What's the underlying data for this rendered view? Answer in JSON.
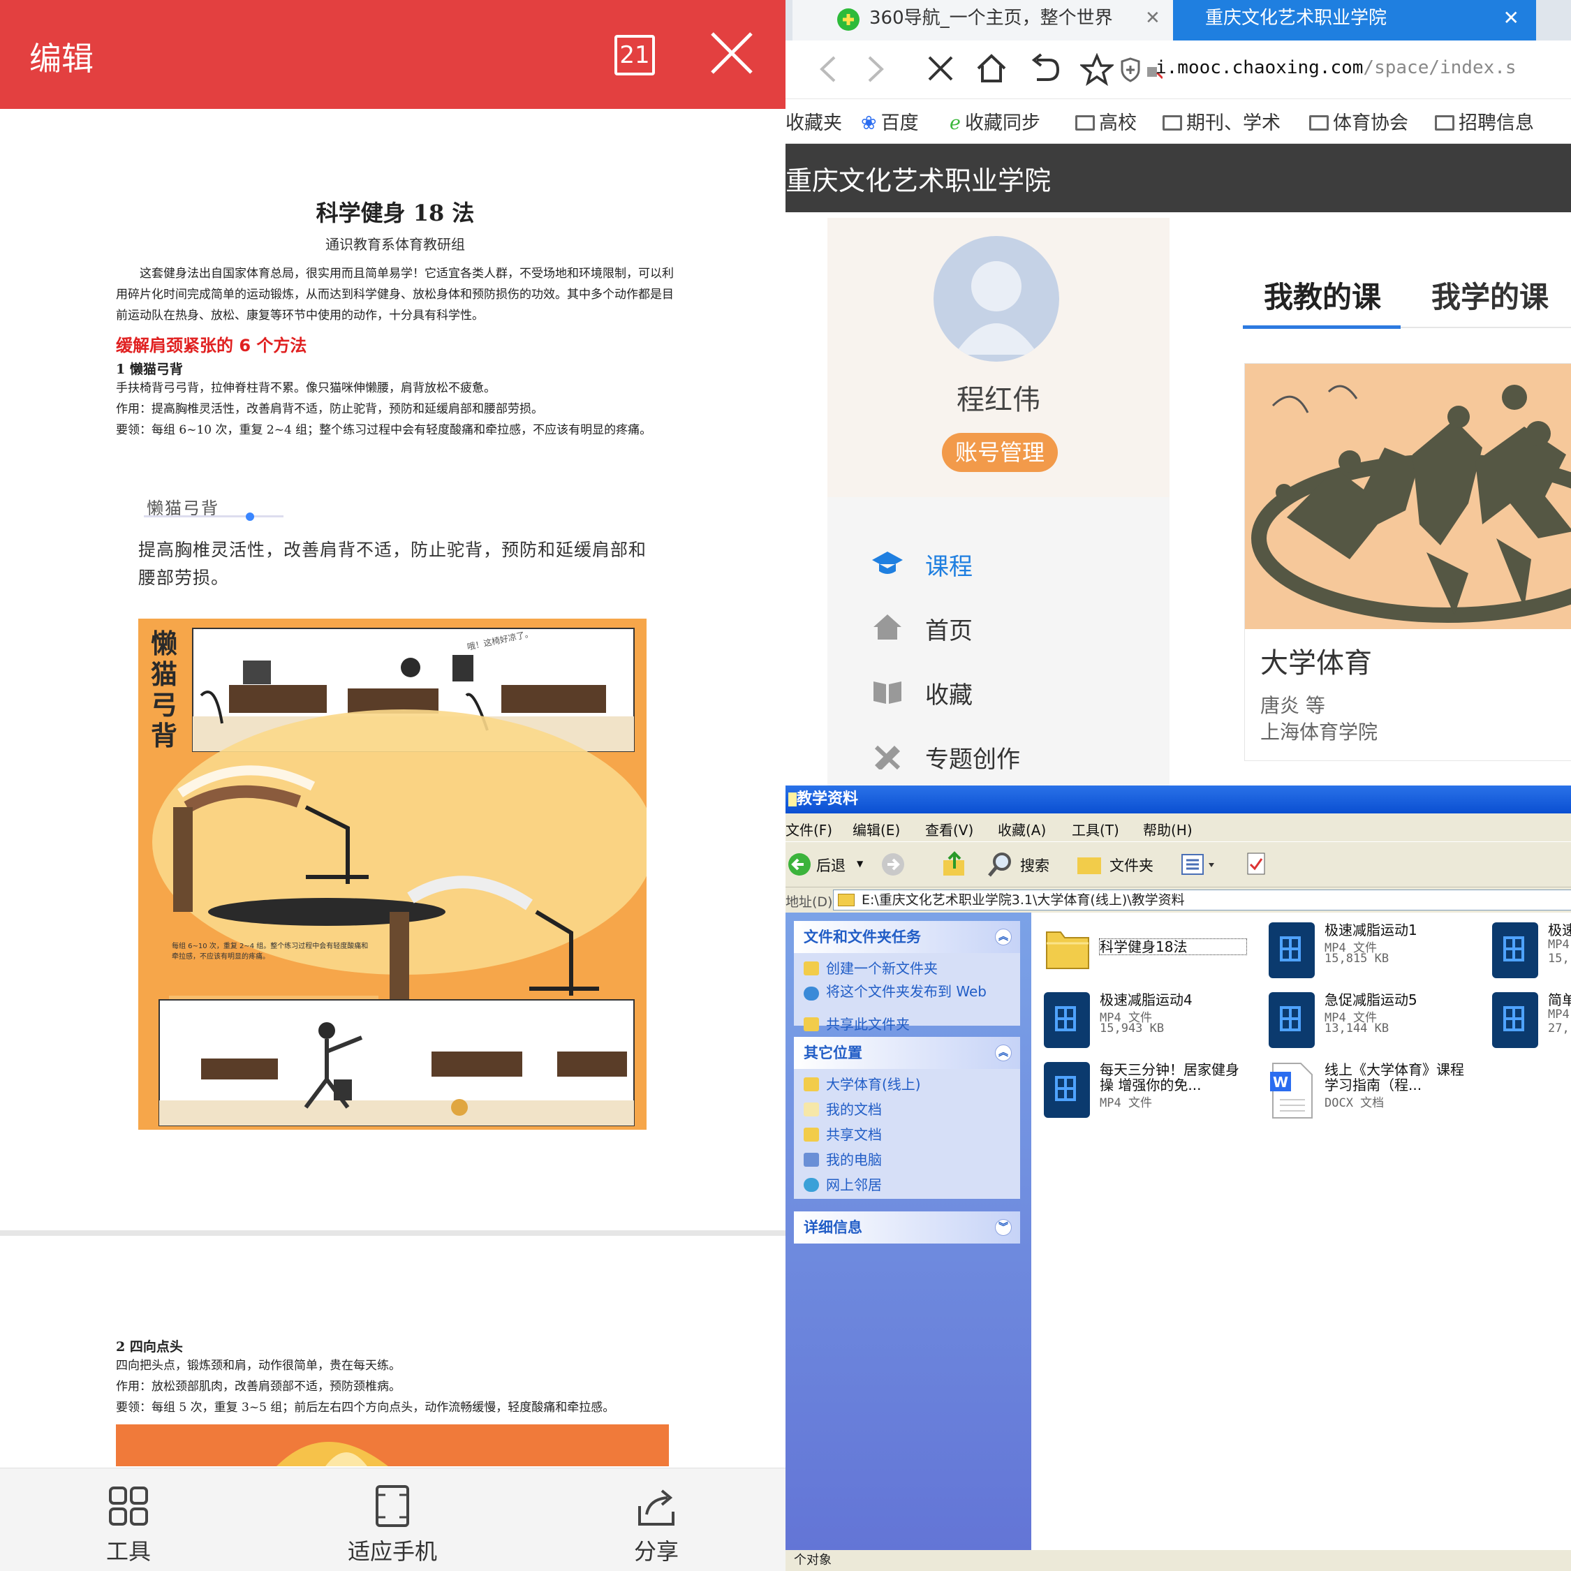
{
  "doc_viewer": {
    "title": "编辑",
    "page_count": "21",
    "doc_title": "科学健身 18 法",
    "doc_subtitle": "通识教育系体育教研组",
    "intro": "这套健身法出自国家体育总局，很实用而且简单易学！它适宜各类人群，不受场地和环境限制，可以利用碎片化时间完成简单的运动锻炼，从而达到科学健身、放松身体和预防损伤的功效。其中多个动作都是目前运动队在热身、放松、康复等环节中使用的动作，十分具有科学性。",
    "section_heading": "缓解肩颈紧张的 6 个方法",
    "item1": {
      "title": "1 懒猫弓背",
      "desc": "手扶椅背弓弓背，拉伸脊柱背不累。像只猫咪伸懒腰，肩背放松不疲惫。",
      "effect": "作用：提高胸椎灵活性，改善肩背不适，防止驼背，预防和延缓肩部和腰部劳损。",
      "method": "要领：每组 6~10 次，重复 2~4 组；整个练习过程中会有轻度酸痛和牵拉感，不应该有明显的疼痛。"
    },
    "illustration": {
      "title": "懒猫弓背",
      "desc": "提高胸椎灵活性，改善肩背不适，防止驼背，预防和延缓肩部和腰部劳损。",
      "vertical_title": "懒猫弓背",
      "speech": "哦！这椅好凉了。",
      "note": "每组 6~10 次，重复 2~4 组。整个练习过程中会有轻度酸痛和牵拉感，不应该有明显的疼痛。"
    },
    "item2": {
      "title": "2 四向点头",
      "desc": "四向把头点，锻炼颈和肩，动作很简单，贵在每天练。",
      "effect": "作用：放松颈部肌肉，改善肩颈部不适，预防颈椎病。",
      "method": "要领：每组 5 次，重复 3~5 组；前后左右四个方向点头，动作流畅缓慢，轻度酸痛和牵拉感。"
    },
    "bottom_bar": [
      {
        "label": "工具"
      },
      {
        "label": "适应手机"
      },
      {
        "label": "分享"
      }
    ],
    "accent_color": "#e34040"
  },
  "browser": {
    "tabs": [
      {
        "label": "360导航_一个主页，整个世界"
      },
      {
        "label": "重庆文化艺术职业学院"
      }
    ],
    "url_host": "i.mooc.chaoxing.com",
    "url_path": "/space/index.s",
    "bookmarks": [
      "收藏夹",
      "百度",
      "收藏同步",
      "高校",
      "期刊、学术",
      "体育协会",
      "招聘信息"
    ],
    "site_name": "重庆文化艺术职业学院",
    "user_name": "程红伟",
    "account_button": "账号管理",
    "menu": [
      {
        "label": "课程",
        "icon": "graduation-cap-icon"
      },
      {
        "label": "首页",
        "icon": "home-icon"
      },
      {
        "label": "收藏",
        "icon": "book-icon"
      },
      {
        "label": "专题创作",
        "icon": "pencil-ruler-icon"
      }
    ],
    "course_tabs": [
      "我教的课",
      "我学的课"
    ],
    "course": {
      "name": "大学体育",
      "teacher": "唐炎 等",
      "school": "上海体育学院"
    }
  },
  "explorer": {
    "title": "教学资料",
    "menu": [
      "文件(F)",
      "编辑(E)",
      "查看(V)",
      "收藏(A)",
      "工具(T)",
      "帮助(H)"
    ],
    "toolbar": {
      "back": "后退",
      "search": "搜索",
      "folders": "文件夹"
    },
    "address_label": "地址(D)",
    "address": "E:\\重庆文化艺术职业学院3.1\\大学体育(线上)\\教学资料",
    "tasks_panel": {
      "title": "文件和文件夹任务",
      "items": [
        "创建一个新文件夹",
        "将这个文件夹发布到 Web",
        "共享此文件夹"
      ]
    },
    "places_panel": {
      "title": "其它位置",
      "items": [
        "大学体育(线上)",
        "我的文档",
        "共享文档",
        "我的电脑",
        "网上邻居"
      ]
    },
    "details_panel": {
      "title": "详细信息"
    },
    "files": [
      {
        "name": "科学健身18法",
        "type": "",
        "size": ""
      },
      {
        "name": "极速减脂运动1",
        "type": "MP4 文件",
        "size": "15,815 KB"
      },
      {
        "name": "极速",
        "type": "MP4",
        "size": "15,"
      },
      {
        "name": "极速减脂运动4",
        "type": "MP4 文件",
        "size": "15,943 KB"
      },
      {
        "name": "急促减脂运动5",
        "type": "MP4 文件",
        "size": "13,144 KB"
      },
      {
        "name": "简单",
        "type": "MP4",
        "size": "27,"
      },
      {
        "name": "每天三分钟！居家健身操 增强你的免...",
        "type": "MP4 文件",
        "size": ""
      },
      {
        "name": "线上《大学体育》课程学习指南（程...",
        "type": "DOCX 文档",
        "size": ""
      }
    ],
    "status": "个对象"
  }
}
